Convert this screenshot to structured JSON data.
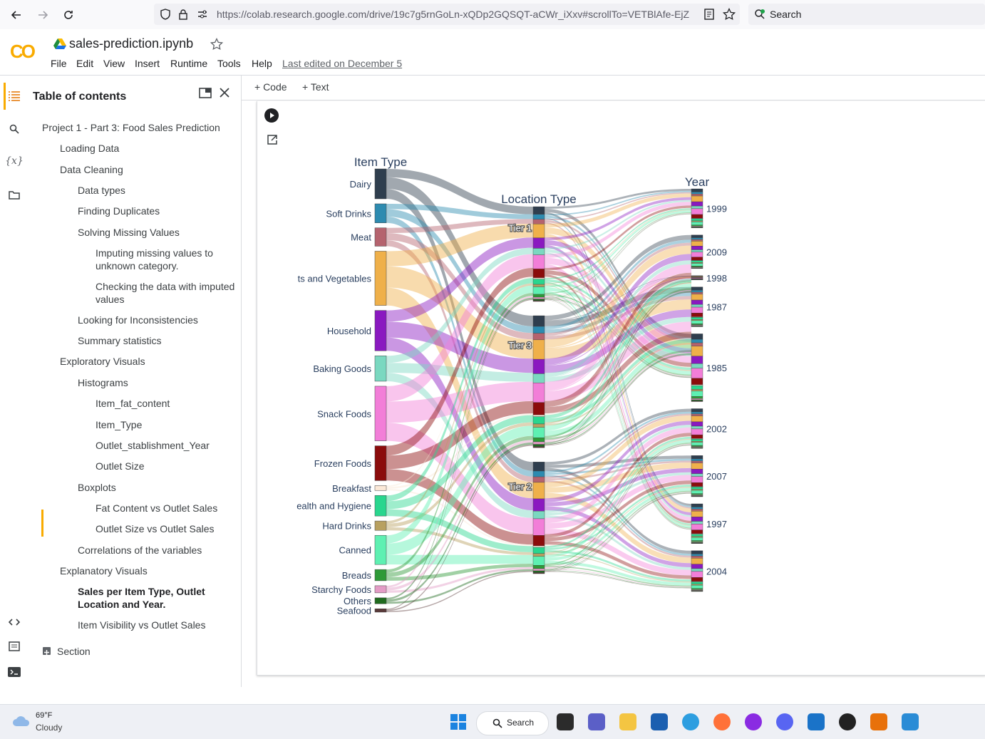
{
  "browser": {
    "url": "https://colab.research.google.com/drive/19c7g5rnGoLn-xQDp2GQSQT-aCWr_iXxv#scrollTo=VETBlAfe-EjZ",
    "search_label": "Search"
  },
  "colab": {
    "logo": "CO",
    "title": "sales-prediction.ipynb",
    "menu": [
      "File",
      "Edit",
      "View",
      "Insert",
      "Runtime",
      "Tools",
      "Help"
    ],
    "last_edited": "Last edited on December 5"
  },
  "toc": {
    "title": "Table of contents",
    "items": [
      {
        "label": "Project 1 - Part 3: Food Sales Prediction",
        "level": 0
      },
      {
        "label": "Loading Data",
        "level": 1
      },
      {
        "label": "Data Cleaning",
        "level": 1
      },
      {
        "label": "Data types",
        "level": 2
      },
      {
        "label": "Finding Duplicates",
        "level": 2
      },
      {
        "label": "Solving Missing Values",
        "level": 2
      },
      {
        "label": "Imputing missing values to unknown category.",
        "level": 3
      },
      {
        "label": "Checking the data with imputed values",
        "level": 3
      },
      {
        "label": "Looking for Inconsistencies",
        "level": 2
      },
      {
        "label": "Summary statistics",
        "level": 2
      },
      {
        "label": "Exploratory Visuals",
        "level": 1
      },
      {
        "label": "Histograms",
        "level": 2
      },
      {
        "label": "Item_fat_content",
        "level": 3
      },
      {
        "label": "Item_Type",
        "level": 3
      },
      {
        "label": "Outlet_stablishment_Year",
        "level": 3
      },
      {
        "label": "Outlet Size",
        "level": 3
      },
      {
        "label": "Boxplots",
        "level": 2
      },
      {
        "label": "Fat Content vs Outlet Sales",
        "level": 3
      },
      {
        "label": "Outlet Size vs Outlet Sales",
        "level": 3
      },
      {
        "label": "Correlations of the variables",
        "level": 2
      },
      {
        "label": "Explanatory Visuals",
        "level": 1
      },
      {
        "label": "Sales per Item Type, Outlet Location and Year.",
        "level": 2,
        "active": true
      },
      {
        "label": "Item Visibility vs Outlet Sales",
        "level": 2
      }
    ],
    "section_label": "Section"
  },
  "toolbar": {
    "code_label": "+ Code",
    "text_label": "+ Text"
  },
  "chart_data": {
    "type": "sankey",
    "columns": [
      "Item Type",
      "Location Type",
      "Year"
    ],
    "item_types": [
      {
        "label": "Dairy",
        "color": "#2f3e4e",
        "value": 8.0
      },
      {
        "label": "Soft Drinks",
        "color": "#2d8bb0",
        "value": 5.1
      },
      {
        "label": "Meat",
        "color": "#b5636e",
        "value": 4.9
      },
      {
        "label": "ts and Vegetables",
        "color": "#efb04a",
        "value": 14.5
      },
      {
        "label": "Household",
        "color": "#8a19c0",
        "value": 10.8
      },
      {
        "label": "Baking Goods",
        "color": "#7ad8c0",
        "value": 6.8
      },
      {
        "label": "Snack Foods",
        "color": "#f27ed8",
        "value": 14.6
      },
      {
        "label": "Frozen Foods",
        "color": "#8b0c0c",
        "value": 9.3
      },
      {
        "label": "Breakfast",
        "color": "#fbe9d8",
        "value": 1.3
      },
      {
        "label": "ealth and Hygiene",
        "color": "#29d68e",
        "value": 5.5
      },
      {
        "label": "Hard Drinks",
        "color": "#b8a060",
        "value": 2.5
      },
      {
        "label": "Canned",
        "color": "#5ef0b2",
        "value": 7.8
      },
      {
        "label": "Breads",
        "color": "#2e9a37",
        "value": 3.0
      },
      {
        "label": "Starchy Foods",
        "color": "#e39cc6",
        "value": 1.9
      },
      {
        "label": "Others",
        "color": "#1f6b1f",
        "value": 1.6
      },
      {
        "label": "Seafood",
        "color": "#5a3a3a",
        "value": 0.9
      }
    ],
    "locations": [
      {
        "label": "Tier 1",
        "value": 28.0
      },
      {
        "label": "Tier 3",
        "value": 39.0
      },
      {
        "label": "Tier 2",
        "value": 33.0
      }
    ],
    "years": [
      {
        "label": "1999",
        "value": 11.3
      },
      {
        "label": "2009",
        "value": 9.7
      },
      {
        "label": "1998",
        "value": 1.2
      },
      {
        "label": "1987",
        "value": 11.5
      },
      {
        "label": "1985",
        "value": 19.6
      },
      {
        "label": "2002",
        "value": 11.5
      },
      {
        "label": "2007",
        "value": 11.9
      },
      {
        "label": "1997",
        "value": 11.5
      },
      {
        "label": "2004",
        "value": 11.8
      }
    ],
    "year_location": {
      "1999": "Tier 1",
      "2009": "Tier 3",
      "1998": "Tier 3",
      "1987": "Tier 3",
      "1985": "Tier 1",
      "2002": "Tier 2",
      "2007": "Tier 2",
      "1997": "Tier 1",
      "2004": "Tier 2"
    }
  },
  "taskbar": {
    "temperature": "69°F",
    "condition": "Cloudy",
    "search_label": "Search"
  }
}
